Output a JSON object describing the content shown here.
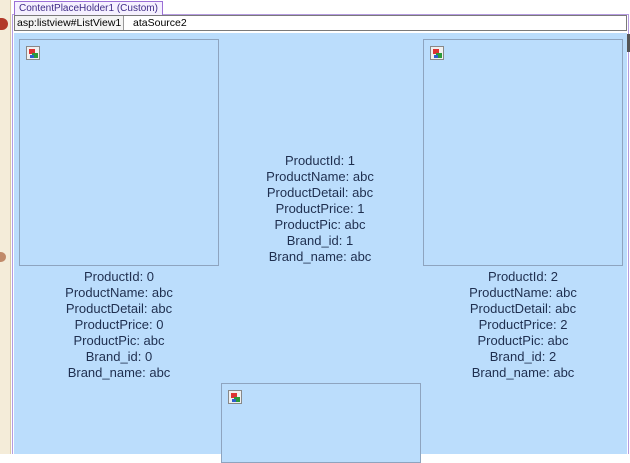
{
  "placeholder": {
    "label": "ContentPlaceHolder1 (Custom)"
  },
  "listview": {
    "tag": "asp:listview#ListView1",
    "datasource_fragment": "ataSource2"
  },
  "items": [
    {
      "product_id": "ProductId: 0",
      "product_name": "ProductName: abc",
      "product_detail": "ProductDetail: abc",
      "product_price": "ProductPrice: 0",
      "product_pic": "ProductPic: abc",
      "brand_id": "Brand_id: 0",
      "brand_name": "Brand_name: abc"
    },
    {
      "product_id": "ProductId: 1",
      "product_name": "ProductName: abc",
      "product_detail": "ProductDetail: abc",
      "product_price": "ProductPrice: 1",
      "product_pic": "ProductPic: abc",
      "brand_id": "Brand_id: 1",
      "brand_name": "Brand_name: abc"
    },
    {
      "product_id": "ProductId: 2",
      "product_name": "ProductName: abc",
      "product_detail": "ProductDetail: abc",
      "product_price": "ProductPrice: 2",
      "product_pic": "ProductPic: abc",
      "brand_id": "Brand_id: 2",
      "brand_name": "Brand_name: abc"
    }
  ],
  "icons": [
    "broken-image-icon"
  ]
}
